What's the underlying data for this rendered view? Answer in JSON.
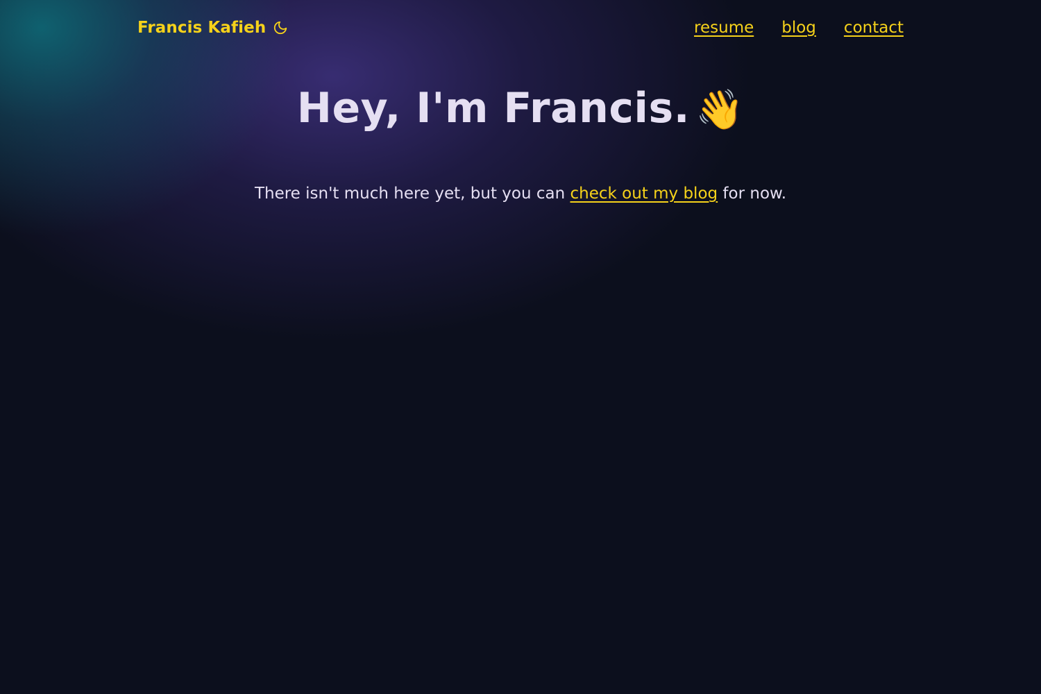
{
  "nav": {
    "brand": "Francis Kafieh",
    "theme_toggle_icon": "moon-icon",
    "links": [
      "resume",
      "blog",
      "contact"
    ]
  },
  "hero": {
    "heading": "Hey, I'm Francis.",
    "emoji": "👋"
  },
  "tagline": {
    "before": "There isn't much here yet, but you can ",
    "link_text": "check out my blog",
    "after": " for now."
  },
  "colors": {
    "background": "#0c0f1d",
    "accent": "#f6d21a",
    "text": "#e5dff2",
    "glow_teal": "#0e6e7a",
    "glow_purple": "#3a2e76"
  }
}
